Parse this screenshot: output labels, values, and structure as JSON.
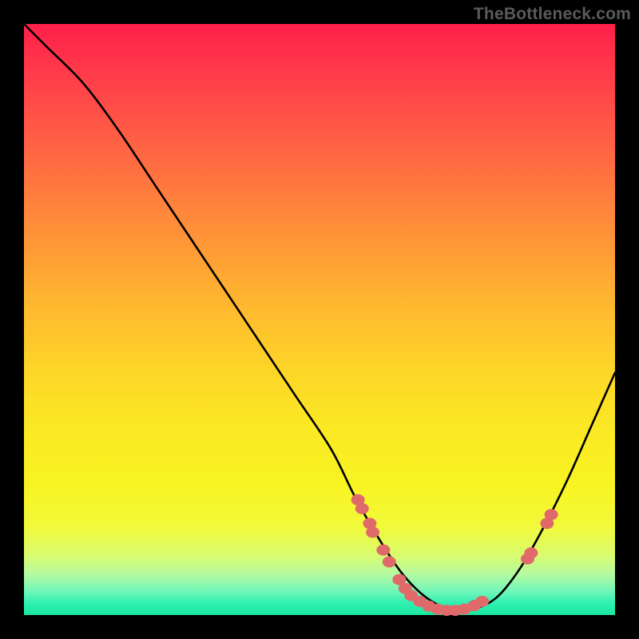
{
  "watermark": "TheBottleneck.com",
  "colors": {
    "curve": "#000000",
    "marker_fill": "#e06a6a",
    "marker_stroke": "#d85c5c"
  },
  "chart_data": {
    "type": "line",
    "title": "",
    "xlabel": "",
    "ylabel": "",
    "xlim": [
      0,
      100
    ],
    "ylim": [
      0,
      100
    ],
    "grid": false,
    "legend": false,
    "series": [
      {
        "name": "bottleneck-curve",
        "x": [
          0,
          4,
          10,
          16,
          22,
          28,
          34,
          40,
          46,
          52,
          56,
          60,
          64,
          68,
          72,
          76,
          80,
          84,
          88,
          92,
          96,
          100
        ],
        "y": [
          100,
          96,
          90,
          82,
          73,
          64,
          55,
          46,
          37,
          28,
          20,
          13,
          7,
          3,
          1,
          1,
          3,
          8,
          15,
          23,
          32,
          41
        ]
      }
    ],
    "markers": [
      {
        "x": 56.5,
        "y": 19.5
      },
      {
        "x": 57.2,
        "y": 18.0
      },
      {
        "x": 58.5,
        "y": 15.5
      },
      {
        "x": 59.0,
        "y": 14.0
      },
      {
        "x": 60.8,
        "y": 11.0
      },
      {
        "x": 61.8,
        "y": 9.0
      },
      {
        "x": 63.5,
        "y": 6.0
      },
      {
        "x": 64.5,
        "y": 4.5
      },
      {
        "x": 65.5,
        "y": 3.3
      },
      {
        "x": 67.0,
        "y": 2.3
      },
      {
        "x": 68.5,
        "y": 1.5
      },
      {
        "x": 70.0,
        "y": 1.0
      },
      {
        "x": 71.5,
        "y": 0.8
      },
      {
        "x": 73.0,
        "y": 0.8
      },
      {
        "x": 74.5,
        "y": 1.0
      },
      {
        "x": 76.2,
        "y": 1.6
      },
      {
        "x": 77.5,
        "y": 2.3
      },
      {
        "x": 85.2,
        "y": 9.5
      },
      {
        "x": 85.8,
        "y": 10.5
      },
      {
        "x": 88.5,
        "y": 15.5
      },
      {
        "x": 89.2,
        "y": 17.0
      }
    ]
  }
}
